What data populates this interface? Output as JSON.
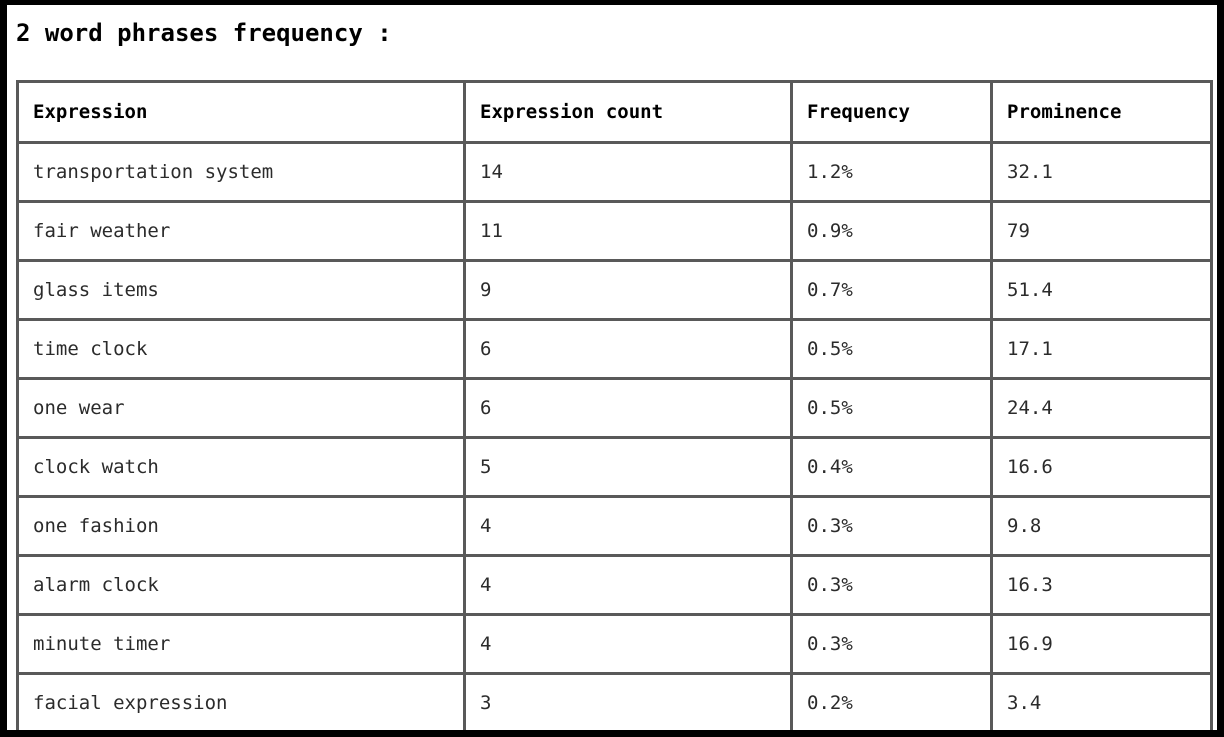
{
  "page": {
    "title": "2 word phrases frequency :",
    "background_color": "#ffffff",
    "frame_color": "#000000",
    "border_color": "#595959",
    "text_color": "#1a1a1a"
  },
  "table": {
    "columns": [
      {
        "key": "expression",
        "label": "Expression"
      },
      {
        "key": "expression_count",
        "label": "Expression count"
      },
      {
        "key": "frequency",
        "label": "Frequency"
      },
      {
        "key": "prominence",
        "label": "Prominence"
      }
    ],
    "rows": [
      {
        "expression": "transportation system",
        "expression_count": "14",
        "frequency": "1.2%",
        "prominence": "32.1"
      },
      {
        "expression": "fair weather",
        "expression_count": "11",
        "frequency": "0.9%",
        "prominence": "79"
      },
      {
        "expression": "glass items",
        "expression_count": "9",
        "frequency": "0.7%",
        "prominence": "51.4"
      },
      {
        "expression": "time clock",
        "expression_count": "6",
        "frequency": "0.5%",
        "prominence": "17.1"
      },
      {
        "expression": "one wear",
        "expression_count": "6",
        "frequency": "0.5%",
        "prominence": "24.4"
      },
      {
        "expression": "clock watch",
        "expression_count": "5",
        "frequency": "0.4%",
        "prominence": "16.6"
      },
      {
        "expression": "one fashion",
        "expression_count": "4",
        "frequency": "0.3%",
        "prominence": "9.8"
      },
      {
        "expression": "alarm clock",
        "expression_count": "4",
        "frequency": "0.3%",
        "prominence": "16.3"
      },
      {
        "expression": "minute timer",
        "expression_count": "4",
        "frequency": "0.3%",
        "prominence": "16.9"
      },
      {
        "expression": "facial expression",
        "expression_count": "3",
        "frequency": "0.2%",
        "prominence": "3.4"
      }
    ]
  }
}
